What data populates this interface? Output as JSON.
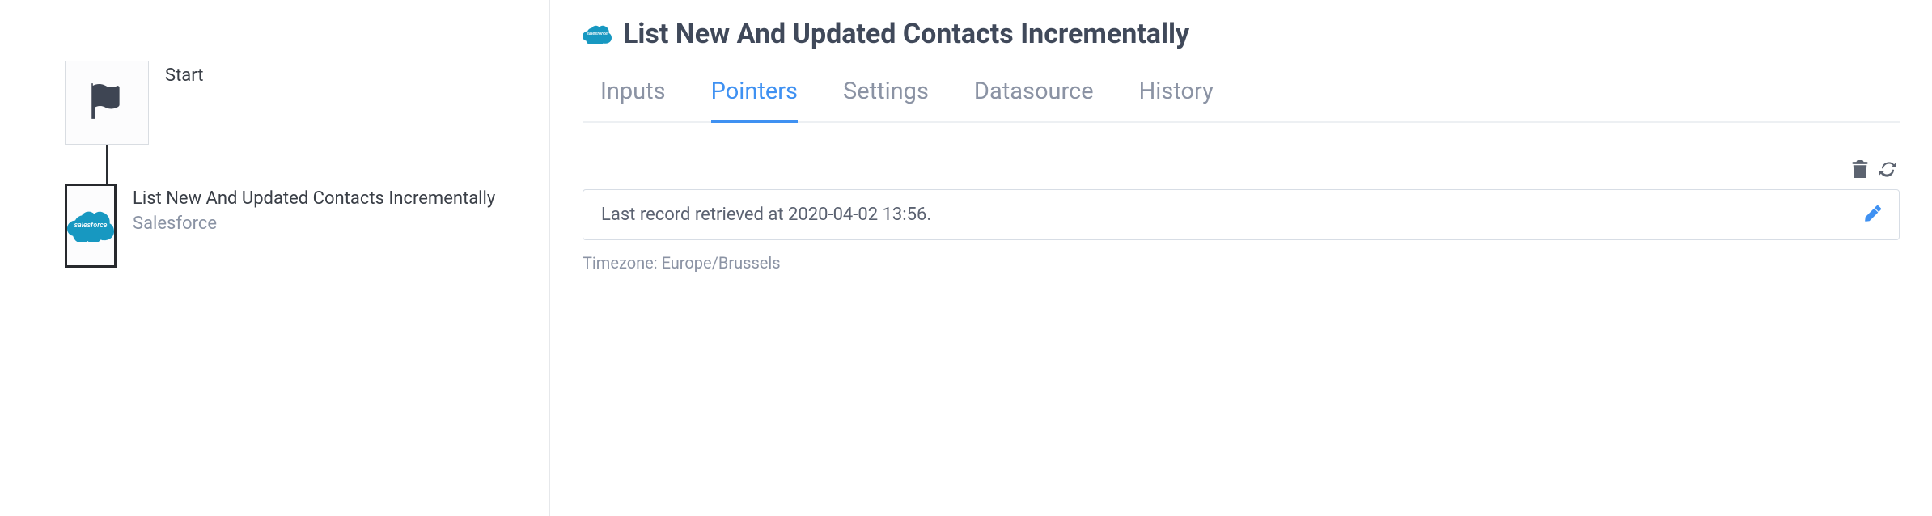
{
  "flow": {
    "start": {
      "label": "Start"
    },
    "step1": {
      "title": "List New And Updated Contacts Incrementally",
      "subtitle": "Salesforce",
      "cloud_text": "salesforce"
    }
  },
  "panel": {
    "title": "List New And Updated Contacts Incrementally",
    "cloud_text": "salesforce",
    "tabs": {
      "inputs": "Inputs",
      "pointers": "Pointers",
      "settings": "Settings",
      "datasource": "Datasource",
      "history": "History"
    },
    "record": "Last record retrieved at 2020-04-02 13:56.",
    "timezone": "Timezone: Europe/Brussels"
  }
}
